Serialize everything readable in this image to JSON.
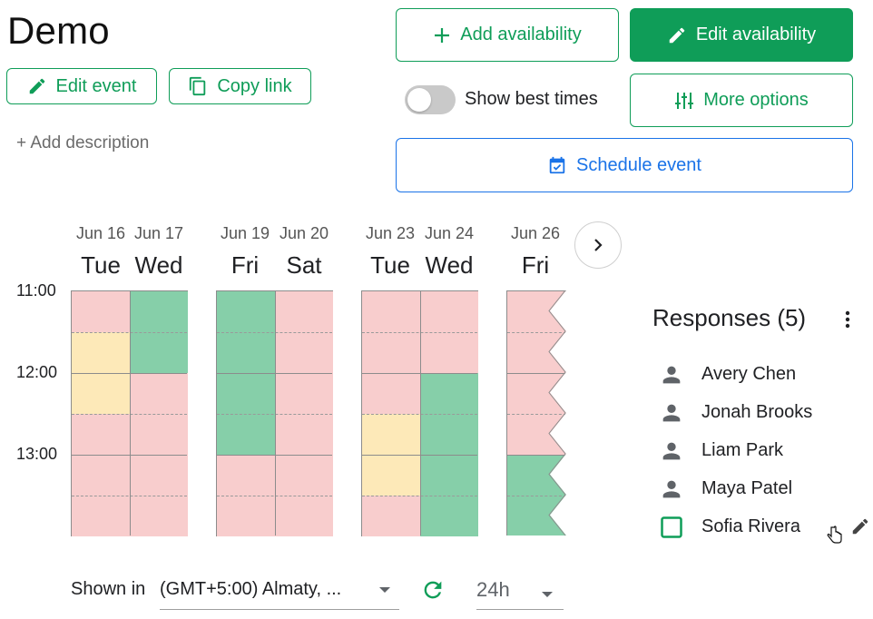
{
  "event": {
    "title": "Demo",
    "edit_event_label": "Edit event",
    "copy_link_label": "Copy link",
    "add_description_label": "+ Add description"
  },
  "actions": {
    "add_availability_label": "Add availability",
    "edit_availability_label": "Edit availability",
    "show_best_times_label": "Show best times",
    "show_best_times_on": false,
    "more_options_label": "More options",
    "schedule_event_label": "Schedule event"
  },
  "colors": {
    "primary_green": "#0f9d58",
    "primary_blue": "#1a73e8",
    "unavailable": "#f8cdcd",
    "partial": "#fde9b8",
    "available": "#86cfa9"
  },
  "calendar": {
    "days": [
      {
        "date": "Jun 16",
        "name": "Tue"
      },
      {
        "date": "Jun 17",
        "name": "Wed"
      },
      {
        "date": "Jun 19",
        "name": "Fri"
      },
      {
        "date": "Jun 20",
        "name": "Sat"
      },
      {
        "date": "Jun 23",
        "name": "Tue"
      },
      {
        "date": "Jun 24",
        "name": "Wed"
      },
      {
        "date": "Jun 26",
        "name": "Fri"
      }
    ],
    "times": [
      "11:00",
      "12:00",
      "13:00"
    ],
    "availability": [
      [
        "unavailable",
        "partial",
        "partial",
        "unavailable",
        "unavailable",
        "unavailable"
      ],
      [
        "available",
        "available",
        "unavailable",
        "unavailable",
        "unavailable",
        "unavailable"
      ],
      [
        "available",
        "available",
        "available",
        "available",
        "unavailable",
        "unavailable"
      ],
      [
        "unavailable",
        "unavailable",
        "unavailable",
        "unavailable",
        "unavailable",
        "unavailable"
      ],
      [
        "unavailable",
        "unavailable",
        "unavailable",
        "partial",
        "partial",
        "unavailable"
      ],
      [
        "unavailable",
        "unavailable",
        "available",
        "available",
        "available",
        "available"
      ],
      [
        "unavailable",
        "unavailable",
        "unavailable",
        "unavailable",
        "available",
        "available"
      ]
    ],
    "next_icon": "chevron-right-icon"
  },
  "responses": {
    "title": "Responses",
    "count": "(5)",
    "people": [
      {
        "name": "Avery Chen",
        "icon": "person-icon"
      },
      {
        "name": "Jonah Brooks",
        "icon": "person-icon"
      },
      {
        "name": "Liam Park",
        "icon": "person-icon"
      },
      {
        "name": "Maya Patel",
        "icon": "person-icon"
      },
      {
        "name": "Sofia Rivera",
        "icon": "checkbox-icon"
      }
    ]
  },
  "footer": {
    "shown_in_label": "Shown in",
    "timezone_value": "(GMT+5:00) Almaty, ...",
    "time_format_value": "24h"
  }
}
